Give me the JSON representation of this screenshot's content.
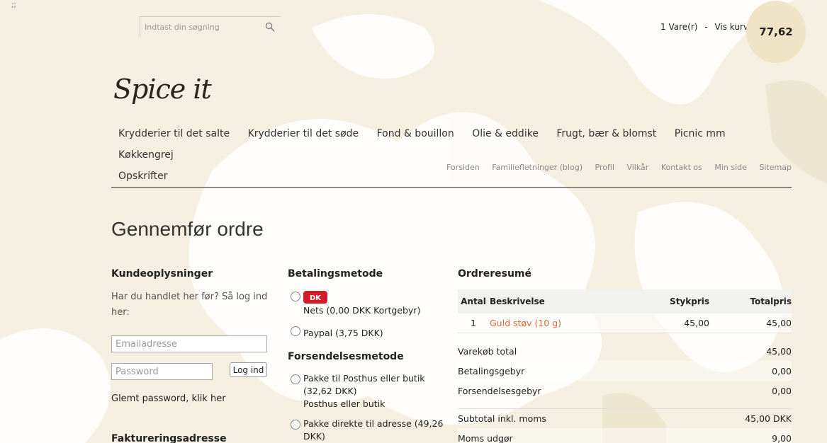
{
  "corner_mark": ";;",
  "search": {
    "placeholder": "Indtast din søgning"
  },
  "cart": {
    "count": "1",
    "items_label": "Vare(r)",
    "separator": "-",
    "view_label": "Vis kurv",
    "total": "77,62"
  },
  "logo": {
    "text": "Spice it"
  },
  "main_nav": [
    "Krydderier til det salte",
    "Krydderier til det søde",
    "Fond & bouillon",
    "Olie & eddike",
    "Frugt, bær & blomst",
    "Picnic mm",
    "Køkkengrej",
    "Opskrifter"
  ],
  "sub_nav": [
    "Forsiden",
    "Familiefletninger (blog)",
    "Profil",
    "Vilkår",
    "Kontakt os",
    "Min side",
    "Sitemap"
  ],
  "page_title": "Gennemfør ordre",
  "customer": {
    "title": "Kundeoplysninger",
    "intro": "Har du handlet her før? Så log ind her:",
    "email_placeholder": "Emailadresse",
    "password_placeholder": "Password",
    "login_label": "Log ind",
    "forgot": "Glemt password, klik her",
    "billing_title": "Faktureringsadresse"
  },
  "payment": {
    "title": "Betalingsmetode",
    "logo_text": "DK",
    "options": [
      "Nets (0,00 DKK Kortgebyr)",
      "Paypal (3,75 DKK)"
    ]
  },
  "shipping": {
    "title": "Forsendelsesmetode",
    "options": [
      {
        "line1": "Pakke til Posthus eller butik",
        "line2": "(32,62 DKK)",
        "line3": "Posthus eller butik"
      },
      {
        "line1": "Pakke direkte til adresse (49,26",
        "line2": "DKK)"
      }
    ]
  },
  "summary": {
    "title": "Ordreresumé",
    "headers": {
      "qty": "Antal",
      "desc": "Beskrivelse",
      "unit": "Stykpris",
      "total": "Totalpris"
    },
    "items": [
      {
        "qty": "1",
        "desc": "Guld støv (10 g)",
        "unit": "45,00",
        "total": "45,00"
      }
    ],
    "rows": [
      {
        "label": "Varekøb total",
        "value": "45,00"
      },
      {
        "label": "Betalingsgebyr",
        "value": "0,00"
      },
      {
        "label": "Forsendelsesgebyr",
        "value": "0,00"
      },
      {
        "label": "Subtotal inkl. moms",
        "value": "45,00 DKK"
      },
      {
        "label": "Moms udgør",
        "value": "9,00"
      }
    ]
  },
  "colors": {
    "accent": "#e06a2f",
    "cart_circle": "#efe4c6",
    "background": "#f6f1e3"
  }
}
